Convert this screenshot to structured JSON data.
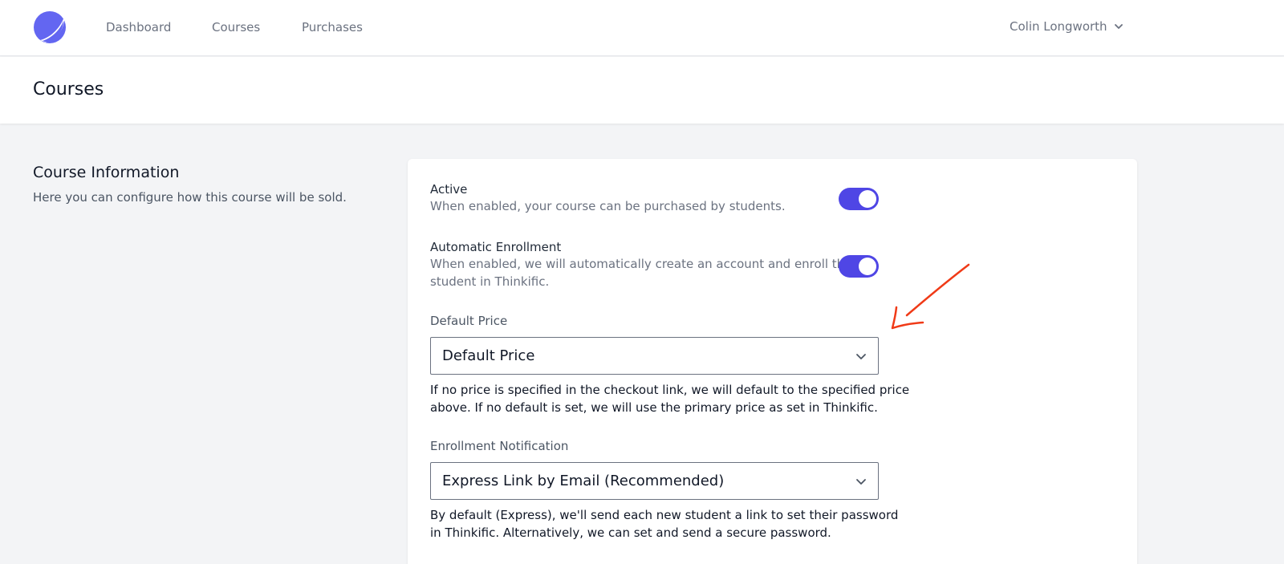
{
  "nav": {
    "items": [
      "Dashboard",
      "Courses",
      "Purchases"
    ],
    "user_name": "Colin Longworth"
  },
  "header": {
    "title": "Courses"
  },
  "section": {
    "title": "Course Information",
    "description": "Here you can configure how this course will be sold."
  },
  "settings": {
    "active": {
      "label": "Active",
      "description": "When enabled, your course can be purchased by students.",
      "enabled": true
    },
    "auto_enroll": {
      "label": "Automatic Enrollment",
      "description_line1": "When enabled, we will automatically create an account and enroll the",
      "description_line2": "student in Thinkific.",
      "enabled": true
    },
    "default_price": {
      "label": "Default Price",
      "value": "Default Price",
      "help_line1": "If no price is specified in the checkout link, we will default to the specified price",
      "help_line2": "above. If no default is set, we will use the primary price as set in Thinkific."
    },
    "notification": {
      "label": "Enrollment Notification",
      "value": "Express Link by Email (Recommended)",
      "help_line1": "By default (Express), we'll send each new student a link to set their password",
      "help_line2": "in Thinkific. Alternatively, we can set and send a secure password."
    }
  },
  "colors": {
    "accent": "#4f46e5",
    "annotation": "#f03a17"
  },
  "icons": [
    "logo-icon",
    "chevron-down-icon",
    "annotation-arrow-icon"
  ]
}
